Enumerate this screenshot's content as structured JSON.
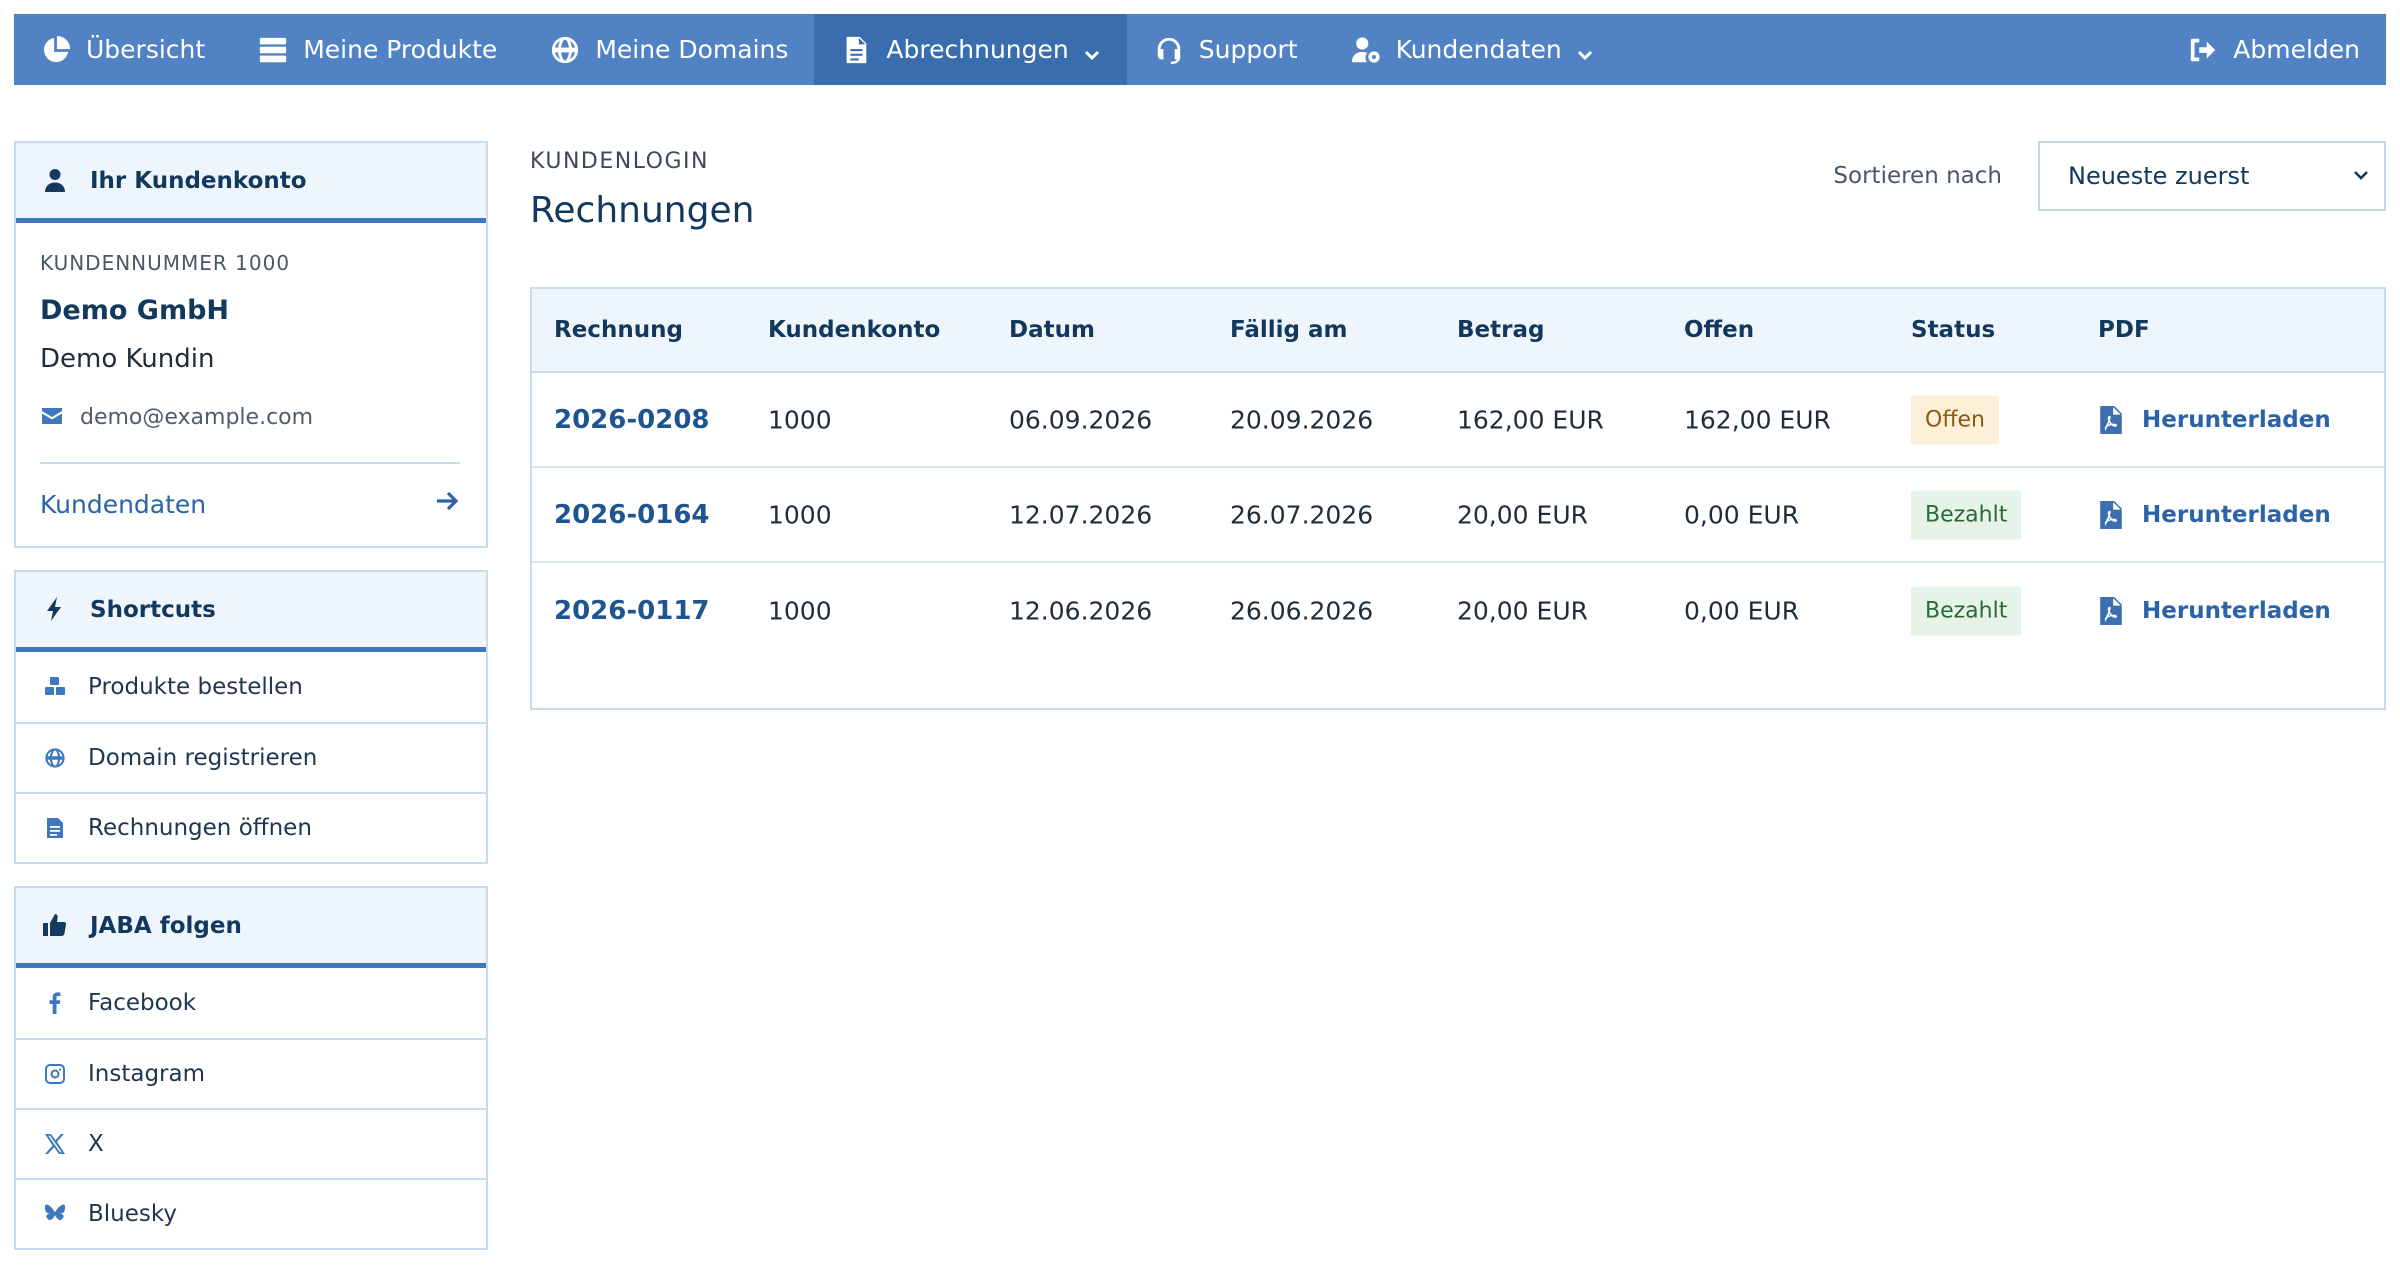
{
  "nav": {
    "items": [
      {
        "label": "Übersicht",
        "icon": "pie-chart-icon"
      },
      {
        "label": "Meine Produkte",
        "icon": "server-icon"
      },
      {
        "label": "Meine Domains",
        "icon": "globe-icon"
      },
      {
        "label": "Abrechnungen",
        "icon": "document-icon",
        "active": true,
        "dropdown": true
      },
      {
        "label": "Support",
        "icon": "headset-icon"
      },
      {
        "label": "Kundendaten",
        "icon": "user-gear-icon",
        "dropdown": true
      }
    ],
    "logout": "Abmelden"
  },
  "account": {
    "title": "Ihr Kundenkonto",
    "number_label": "KUNDENNUMMER 1000",
    "company": "Demo GmbH",
    "contact": "Demo Kundin",
    "email": "demo@example.com",
    "link": "Kundendaten"
  },
  "shortcuts": {
    "title": "Shortcuts",
    "items": [
      "Produkte bestellen",
      "Domain registrieren",
      "Rechnungen öffnen"
    ]
  },
  "follow": {
    "title": "JABA folgen",
    "items": [
      "Facebook",
      "Instagram",
      "X",
      "Bluesky"
    ]
  },
  "main": {
    "eyebrow": "KUNDENLOGIN",
    "title": "Rechnungen",
    "sort_label": "Sortieren nach",
    "sort_value": "Neueste zuerst"
  },
  "table": {
    "headers": [
      "Rechnung",
      "Kundenkonto",
      "Datum",
      "Fällig am",
      "Betrag",
      "Offen",
      "Status",
      "PDF"
    ],
    "rows": [
      {
        "invoice": "2026-0208",
        "account": "1000",
        "date": "06.09.2026",
        "due": "20.09.2026",
        "amount": "162,00 EUR",
        "open": "162,00 EUR",
        "status": "Offen",
        "pdf": "Herunterladen"
      },
      {
        "invoice": "2026-0164",
        "account": "1000",
        "date": "12.07.2026",
        "due": "26.07.2026",
        "amount": "20,00 EUR",
        "open": "0,00 EUR",
        "status": "Bezahlt",
        "pdf": "Herunterladen"
      },
      {
        "invoice": "2026-0117",
        "account": "1000",
        "date": "12.06.2026",
        "due": "26.06.2026",
        "amount": "20,00 EUR",
        "open": "0,00 EUR",
        "status": "Bezahlt",
        "pdf": "Herunterladen"
      }
    ]
  },
  "colors": {
    "nav_bg": "#5183c4",
    "nav_active": "#3a6dae",
    "accent": "#3d78bd",
    "heading": "#13385e",
    "badge_open_bg": "#fdf0d8",
    "badge_paid_bg": "#e6f3e8"
  }
}
